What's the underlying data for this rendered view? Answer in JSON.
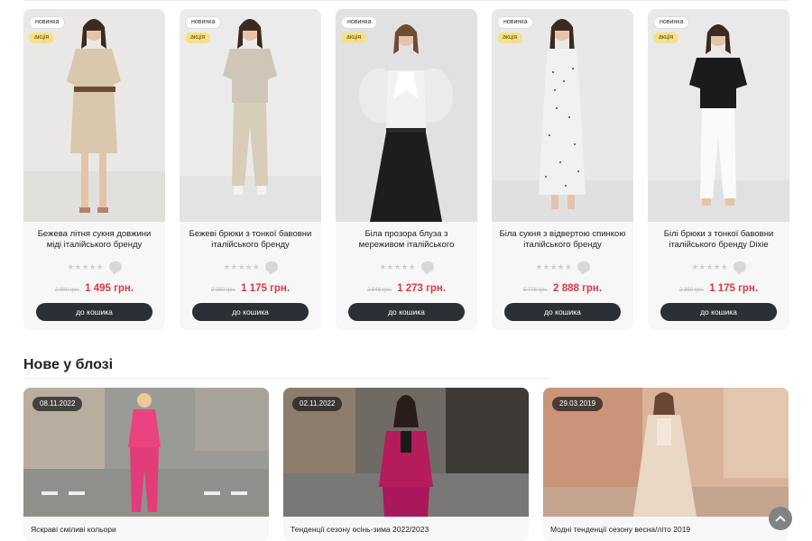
{
  "products": [
    {
      "badge_new": "новинка",
      "badge_sale": "акція",
      "title": "Бежева літня сукня довжини міді італійського бренду",
      "stars": "★★★★★",
      "old_price": "2 990 грн.",
      "price": "1 495 грн.",
      "cart_label": "до кошика",
      "image": "woman-beige-dress"
    },
    {
      "badge_new": "новинка",
      "badge_sale": "акція",
      "title": "Бежеві брюки з тонкої бавовни італійського бренду",
      "stars": "★★★★★",
      "old_price": "2 350 грн.",
      "price": "1 175 грн.",
      "cart_label": "до кошика",
      "image": "woman-beige-pants"
    },
    {
      "badge_new": "новинка",
      "badge_sale": "акція",
      "title": "Біла прозора блуза з мереживом італійського",
      "stars": "★★★★★",
      "old_price": "2 546 грн.",
      "price": "1 273 грн.",
      "cart_label": "до кошика",
      "image": "woman-white-blouse"
    },
    {
      "badge_new": "новинка",
      "badge_sale": "акція",
      "title": "Біла сукня з відвертою спинкою італійського бренду",
      "stars": "★★★★★",
      "old_price": "5 776 грн.",
      "price": "2 888 грн.",
      "cart_label": "до кошика",
      "image": "woman-polka-dress"
    },
    {
      "badge_new": "новинка",
      "badge_sale": "акція",
      "title": "Білі брюки з тонкої бавовни італійського бренду Dixie",
      "stars": "★★★★★",
      "old_price": "2 350 грн.",
      "price": "1 175 грн.",
      "cart_label": "до кошика",
      "image": "woman-white-pants"
    }
  ],
  "blog": {
    "heading": "Нове у блозі",
    "posts": [
      {
        "date": "08.11.2022",
        "title": "Яскраві сміливі кольори",
        "image": "woman-pink-suit-street"
      },
      {
        "date": "02.11.2022",
        "title": "Тенденції сезону осінь-зима 2022/2023",
        "image": "woman-magenta-velvet-suit"
      },
      {
        "date": "29.03.2019",
        "title": "Модні тенденції сезону весна/літо 2019",
        "image": "woman-beige-coat-sunset"
      }
    ]
  },
  "icons": {
    "scroll_top": "chevron-up-icon",
    "comments": "comment-icon",
    "rating": "star-icon"
  },
  "colors": {
    "price": "#e0383e",
    "button": "#2c2f36",
    "sale_badge": "#f5e08a"
  }
}
